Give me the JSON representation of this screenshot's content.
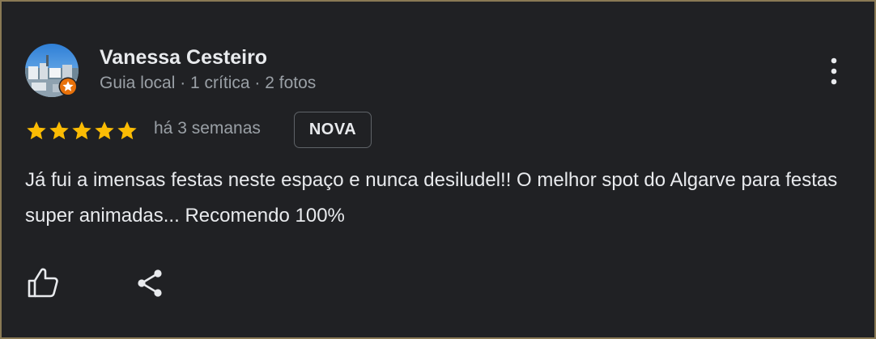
{
  "review": {
    "author_name": "Vanessa Cesteiro",
    "author_meta": "Guia local · 1 crítica · 2 fotos",
    "rating": 5,
    "rating_max": 5,
    "time_ago": "há 3 semanas",
    "new_tag": "NOVA",
    "text": "Já fui a imensas festas neste espaço e nunca desiludel!! O melhor spot do Algarve para festas super animadas... Recomendo 100%"
  },
  "icons": {
    "more": "more-vert-icon",
    "like": "thumbs-up-icon",
    "share": "share-icon",
    "badge": "local-guide-star-badge"
  },
  "colors": {
    "background": "#202124",
    "border": "#8a7a55",
    "star": "#fbbc04",
    "badge": "#e8710a",
    "text_primary": "#e8eaed",
    "text_secondary": "#9aa0a6"
  }
}
